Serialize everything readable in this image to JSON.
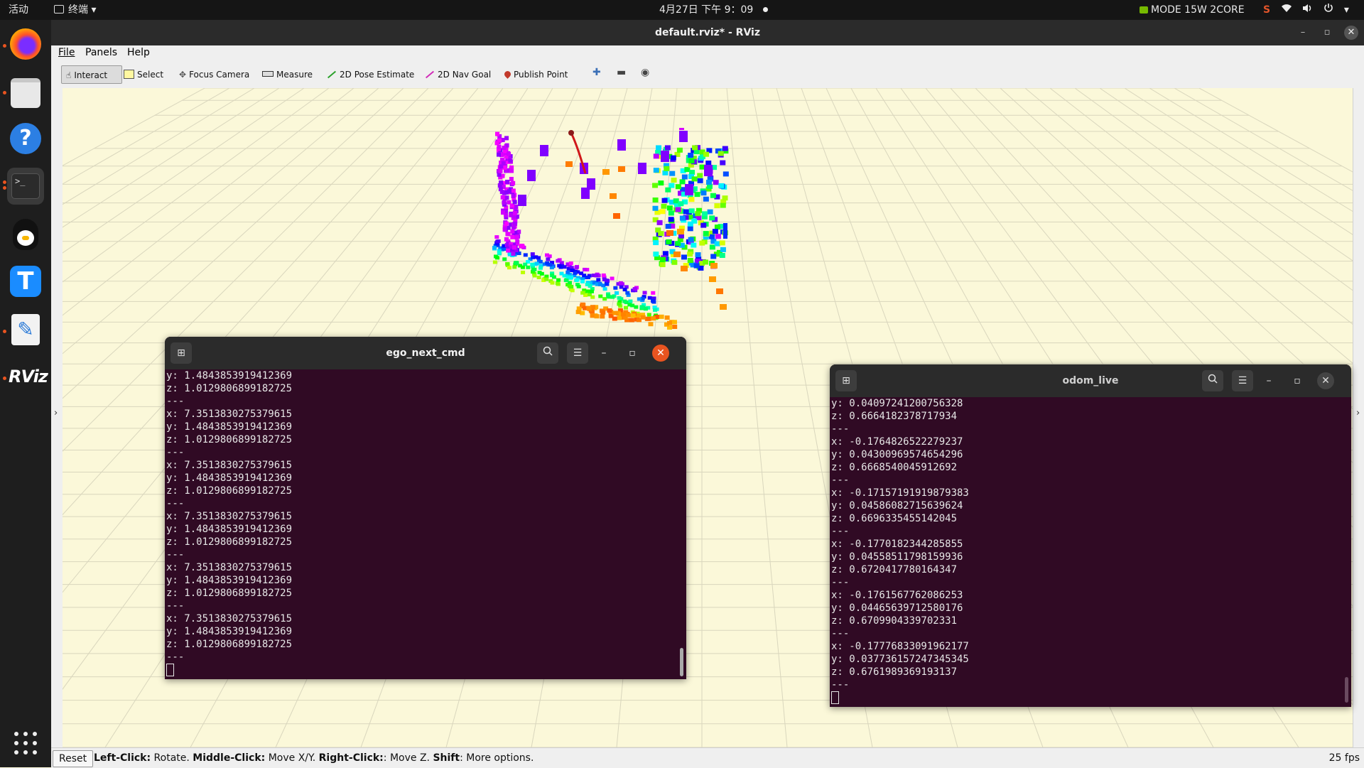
{
  "topbar": {
    "activities": "活动",
    "app_menu": "终端 ▾",
    "clock": "4月27日 下午 9：09",
    "nvidia_mode": "MODE 15W 2CORE",
    "tray": [
      "S",
      "wifi",
      "vol",
      "power",
      "▾"
    ]
  },
  "dock": {
    "items": [
      "firefox",
      "files",
      "help",
      "terminal",
      "qq",
      "todesk",
      "text-editor",
      "rviz"
    ],
    "help_glyph": "?",
    "terminal_glyph": ">_",
    "rviz_label": "RViz"
  },
  "rviz": {
    "title": "default.rviz* - RViz",
    "menu": [
      "File",
      "Panels",
      "Help"
    ],
    "tools": [
      "Interact",
      "Select",
      "Focus Camera",
      "Measure",
      "2D Pose Estimate",
      "2D Nav Goal",
      "Publish Point"
    ],
    "status": {
      "reset": "Reset",
      "hint_parts": [
        {
          "b": "Left-Click:",
          "t": " Rotate. "
        },
        {
          "b": "Middle-Click:",
          "t": " Move X/Y. "
        },
        {
          "b": "Right-Click:",
          "t": ": Move Z. "
        },
        {
          "b": "Shift",
          "t": ": More options."
        }
      ],
      "fps": "25 fps"
    }
  },
  "terminals": [
    {
      "id": "ego",
      "title": "ego_next_cmd",
      "lines": [
        "y: 1.4843853919412369",
        "z: 1.0129806899182725",
        "---",
        "x: 7.3513830275379615",
        "y: 1.4843853919412369",
        "z: 1.0129806899182725",
        "---",
        "x: 7.3513830275379615",
        "y: 1.4843853919412369",
        "z: 1.0129806899182725",
        "---",
        "x: 7.3513830275379615",
        "y: 1.4843853919412369",
        "z: 1.0129806899182725",
        "---",
        "x: 7.3513830275379615",
        "y: 1.4843853919412369",
        "z: 1.0129806899182725",
        "---",
        "x: 7.3513830275379615",
        "y: 1.4843853919412369",
        "z: 1.0129806899182725",
        "---"
      ]
    },
    {
      "id": "odom",
      "title": "odom_live",
      "lines": [
        "y: 0.04097241200756328",
        "z: 0.6664182378717934",
        "---",
        "x: -0.1764826522279237",
        "y: 0.04300969574654296",
        "z: 0.6668540045912692",
        "---",
        "x: -0.17157191919879383",
        "y: 0.04586082715639624",
        "z: 0.6696335455142045",
        "---",
        "x: -0.1770182344285855",
        "y: 0.04558511798159936",
        "z: 0.6720417780164347",
        "---",
        "x: -0.1761567762086253",
        "y: 0.04465639712580176",
        "z: 0.6709904339702331",
        "---",
        "x: -0.17776833091962177",
        "y: 0.037736157247345345",
        "z: 0.6761989369193137",
        "---"
      ]
    }
  ],
  "colors": {
    "terminal_bg": "#300a24",
    "grid_bg": "#fbf8d9",
    "accent_close": "#e95420"
  }
}
